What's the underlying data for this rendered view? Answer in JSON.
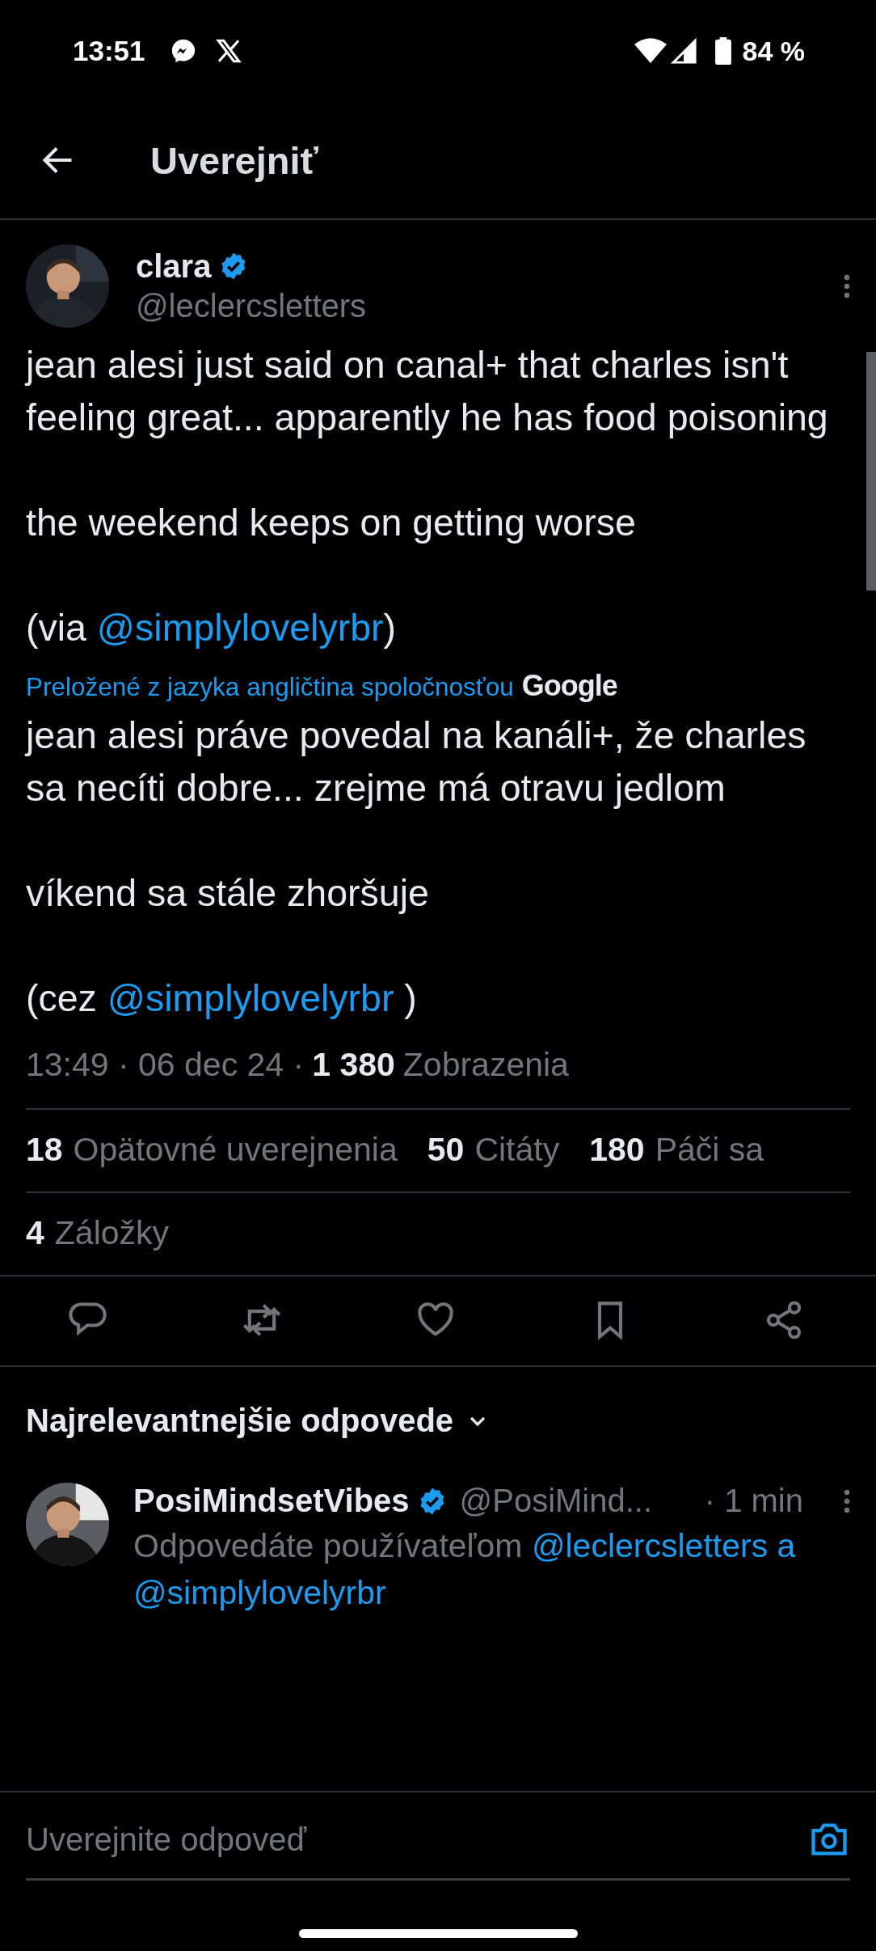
{
  "status_bar": {
    "time": "13:51",
    "battery": "84 %"
  },
  "header": {
    "title": "Uverejniť"
  },
  "post": {
    "author": {
      "name": "clara",
      "verified": true,
      "handle": "@leclercsletters"
    },
    "paragraphs": [
      [
        {
          "kind": "plain",
          "text": "jean alesi just said on canal+ that charles isn't feeling great... apparently he has food poisoning"
        }
      ],
      [
        {
          "kind": "plain",
          "text": "the weekend keeps on getting worse"
        }
      ],
      [
        {
          "kind": "plain",
          "text": "(via "
        },
        {
          "kind": "mention",
          "text": "@simplylovelyrbr"
        },
        {
          "kind": "plain",
          "text": ")"
        }
      ]
    ],
    "translation_note": "Preložené z jazyka angličtina spoločnosťou",
    "translation_provider": "Google",
    "translated_paragraphs": [
      [
        {
          "kind": "plain",
          "text": "jean alesi práve povedal na kanáli+, že charles sa necíti dobre... zrejme má otravu jedlom"
        }
      ],
      [
        {
          "kind": "plain",
          "text": "víkend sa stále zhoršuje"
        }
      ],
      [
        {
          "kind": "plain",
          "text": "(cez "
        },
        {
          "kind": "mention",
          "text": "@simplylovelyrbr"
        },
        {
          "kind": "plain",
          "text": " )"
        }
      ]
    ],
    "time": "13:49 · 06 dec 24 ·",
    "views_count": "1 380",
    "views_label": "Zobrazenia",
    "stats": [
      {
        "count": "18",
        "label": "Opätovné uverejnenia"
      },
      {
        "count": "50",
        "label": "Citáty"
      },
      {
        "count": "180",
        "label": "Páči sa"
      }
    ],
    "bookmarks": {
      "count": "4",
      "label": "Záložky"
    },
    "actions": [
      {
        "kind": "reply"
      },
      {
        "kind": "repost"
      },
      {
        "kind": "like"
      },
      {
        "kind": "bookmark"
      },
      {
        "kind": "share"
      }
    ]
  },
  "replies": {
    "sort_label": "Najrelevantnejšie odpovede",
    "items": [
      {
        "name": "PosiMindsetVibes",
        "verified": true,
        "handle": "@PosiMind...",
        "time": "· 1 min",
        "context": [
          {
            "kind": "plain",
            "text": "Odpovedáte používateľom "
          },
          {
            "kind": "mention",
            "text": "@leclercsletters a "
          },
          {
            "kind": "mention",
            "text": "@simplylovelyrbr"
          }
        ]
      }
    ]
  },
  "compose": {
    "placeholder": "Uverejnite odpoveď"
  }
}
